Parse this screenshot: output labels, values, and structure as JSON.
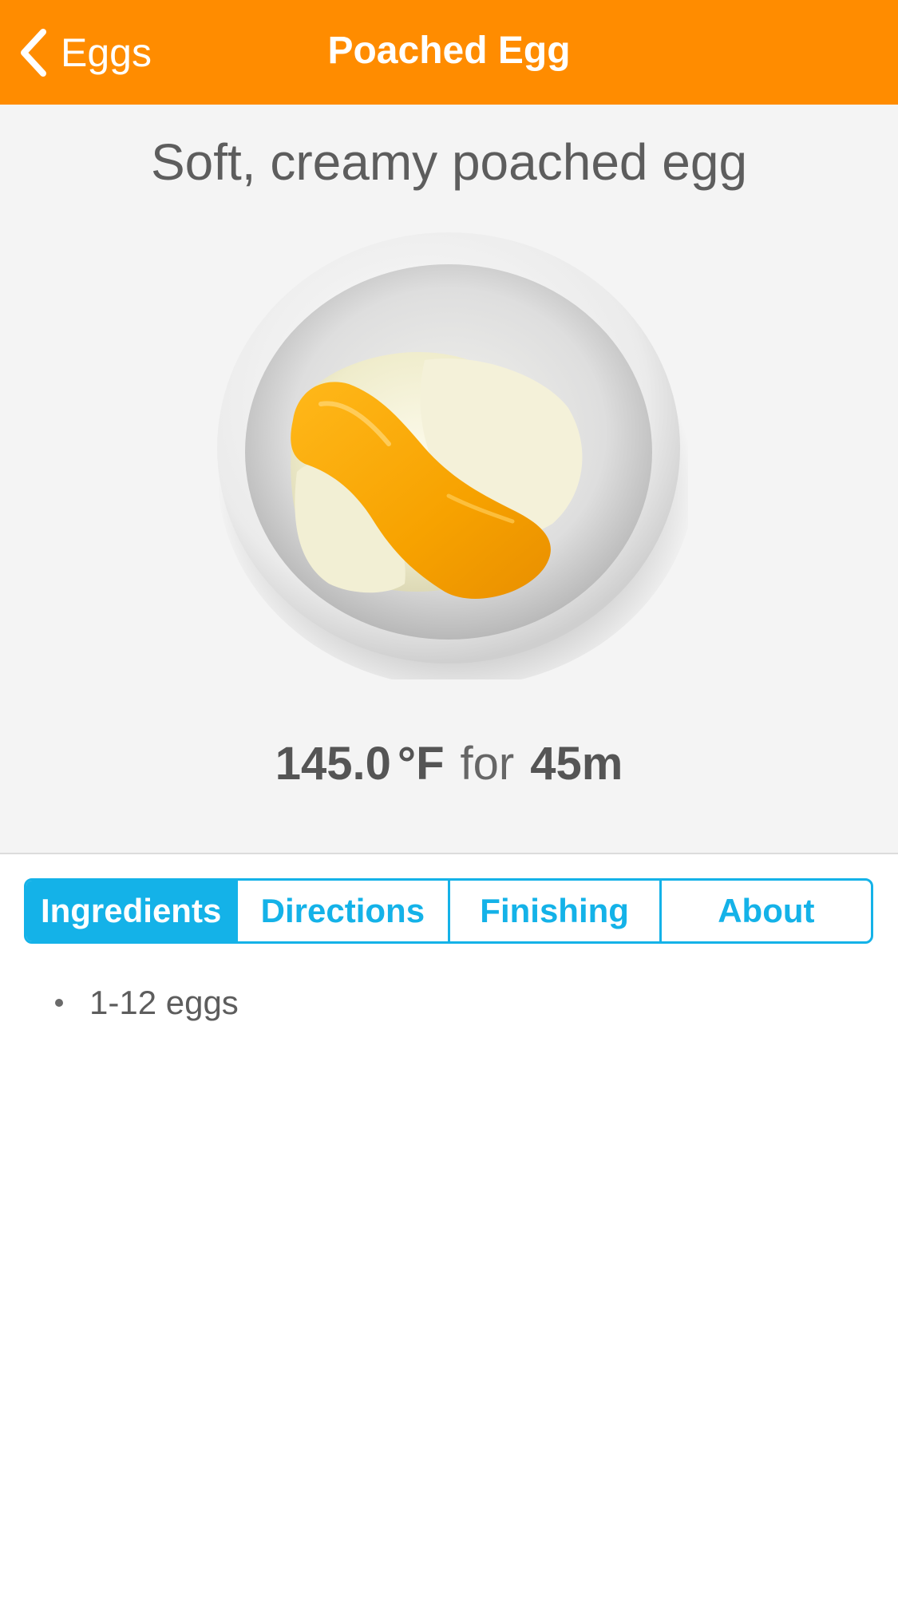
{
  "nav": {
    "back_label": "Eggs",
    "title": "Poached Egg",
    "back_icon": "chevron-left-icon",
    "bar_color": "#FF8C00"
  },
  "recipe": {
    "subtitle": "Soft, creamy poached egg",
    "temperature": "145.0",
    "temperature_unit": "°F",
    "connector": "for",
    "duration": "45m",
    "photo": "poached-egg-in-bowl"
  },
  "tabs": {
    "accent_color": "#14B2E8",
    "items": [
      {
        "label": "Ingredients",
        "active": true
      },
      {
        "label": "Directions",
        "active": false
      },
      {
        "label": "Finishing",
        "active": false
      },
      {
        "label": "About",
        "active": false
      }
    ]
  },
  "ingredients": [
    "1-12 eggs"
  ]
}
